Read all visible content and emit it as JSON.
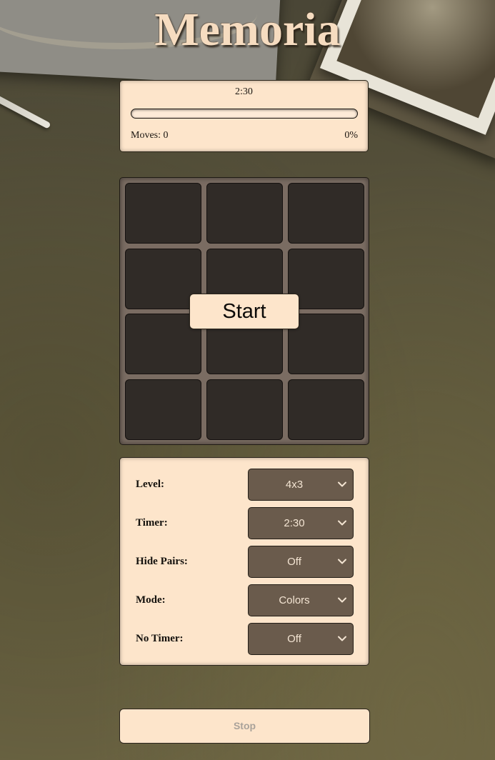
{
  "title": "Memoria",
  "status": {
    "timer": "2:30",
    "progress_fraction": 0,
    "moves_label": "Moves: 0",
    "percent_label": "0%"
  },
  "board": {
    "rows": 4,
    "columns": 3,
    "start_label": "Start"
  },
  "settings": [
    {
      "label": "Level:",
      "value": "4x3"
    },
    {
      "label": "Timer:",
      "value": "2:30"
    },
    {
      "label": "Hide Pairs:",
      "value": "Off"
    },
    {
      "label": "Mode:",
      "value": "Colors"
    },
    {
      "label": "No Timer:",
      "value": "Off"
    }
  ],
  "stop_label": "Stop",
  "colors": {
    "panel": "#fde5cb",
    "card": "#302b27",
    "board": "#7a6c62",
    "select": "#6a5b4c",
    "title": "#f6dcc0"
  },
  "icons": {
    "select_arrow": "chevron-down-icon"
  }
}
